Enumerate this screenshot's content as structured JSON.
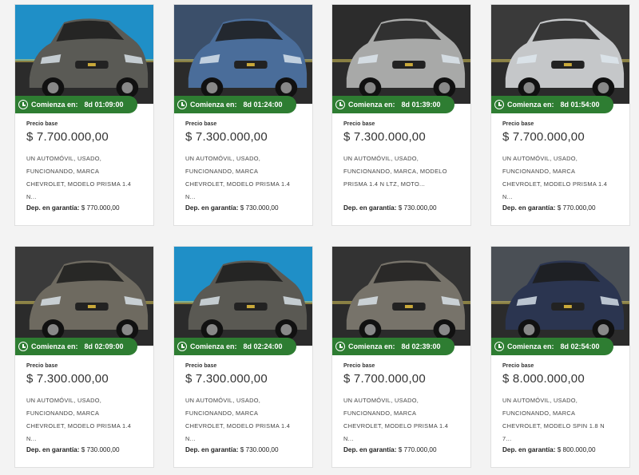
{
  "cards": [
    {
      "starts_label": "Comienza en:",
      "countdown": "8d 01:09:00",
      "base_label": "Precio base",
      "price": "$ 7.700.000,00",
      "desc_lines": [
        "UN AUTOMÓVIL, USADO,",
        "FUNCIONANDO, MARCA",
        "CHEVROLET, MODELO PRISMA 1.4",
        "N..."
      ],
      "deposit_label": "Dep. en garantía:",
      "deposit_value": "$ 770.000,00",
      "car_color": "#5a5a55",
      "bg_color": "#1f8fc7"
    },
    {
      "starts_label": "Comienza en:",
      "countdown": "8d 01:24:00",
      "base_label": "Precio base",
      "price": "$ 7.300.000,00",
      "desc_lines": [
        "UN AUTOMÓVIL, USADO,",
        "FUNCIONANDO, MARCA",
        "CHEVROLET, MODELO PRISMA 1.4",
        "N..."
      ],
      "deposit_label": "Dep. en garantía:",
      "deposit_value": "$ 730.000,00",
      "car_color": "#4a6d9a",
      "bg_color": "#3b4f6a"
    },
    {
      "starts_label": "Comienza en:",
      "countdown": "8d 01:39:00",
      "base_label": "Precio base",
      "price": "$ 7.300.000,00",
      "desc_lines": [
        "UN AUTOMÓVIL, USADO,",
        "FUNCIONANDO, MARCA, MODELO",
        "PRISMA 1.4 N LTZ, MOTO..."
      ],
      "deposit_label": "Dep. en garantía:",
      "deposit_value": "$ 730.000,00",
      "car_color": "#a8a9a8",
      "bg_color": "#2c2c2c"
    },
    {
      "starts_label": "Comienza en:",
      "countdown": "8d 01:54:00",
      "base_label": "Precio base",
      "price": "$ 7.700.000,00",
      "desc_lines": [
        "UN AUTOMÓVIL, USADO,",
        "FUNCIONANDO, MARCA",
        "CHEVROLET, MODELO PRISMA 1.4",
        "N..."
      ],
      "deposit_label": "Dep. en garantía:",
      "deposit_value": "$ 770.000,00",
      "car_color": "#c5c7c9",
      "bg_color": "#3a3a3a"
    },
    {
      "starts_label": "Comienza en:",
      "countdown": "8d 02:09:00",
      "base_label": "Precio base",
      "price": "$ 7.300.000,00",
      "desc_lines": [
        "UN AUTOMÓVIL, USADO,",
        "FUNCIONANDO, MARCA",
        "CHEVROLET, MODELO PRISMA 1.4",
        "N..."
      ],
      "deposit_label": "Dep. en garantía:",
      "deposit_value": "$ 730.000,00",
      "car_color": "#6e6a60",
      "bg_color": "#3a3a3a"
    },
    {
      "starts_label": "Comienza en:",
      "countdown": "8d 02:24:00",
      "base_label": "Precio base",
      "price": "$ 7.300.000,00",
      "desc_lines": [
        "UN AUTOMÓVIL, USADO,",
        "FUNCIONANDO, MARCA",
        "CHEVROLET, MODELO PRISMA 1.4",
        "N..."
      ],
      "deposit_label": "Dep. en garantía:",
      "deposit_value": "$ 730.000,00",
      "car_color": "#5a5953",
      "bg_color": "#1f8fc7"
    },
    {
      "starts_label": "Comienza en:",
      "countdown": "8d 02:39:00",
      "base_label": "Precio base",
      "price": "$ 7.700.000,00",
      "desc_lines": [
        "UN AUTOMÓVIL, USADO,",
        "FUNCIONANDO, MARCA",
        "CHEVROLET, MODELO PRISMA 1.4",
        "N..."
      ],
      "deposit_label": "Dep. en garantía:",
      "deposit_value": "$ 770.000,00",
      "car_color": "#77736a",
      "bg_color": "#333333"
    },
    {
      "starts_label": "Comienza en:",
      "countdown": "8d 02:54:00",
      "base_label": "Precio base",
      "price": "$ 8.000.000,00",
      "desc_lines": [
        "UN AUTOMÓVIL, USADO,",
        "FUNCIONANDO, MARCA",
        "CHEVROLET, MODELO SPIN 1.8 N",
        "7..."
      ],
      "deposit_label": "Dep. en garantía:",
      "deposit_value": "$ 800.000,00",
      "car_color": "#2b3550",
      "bg_color": "#4a4f55"
    }
  ]
}
